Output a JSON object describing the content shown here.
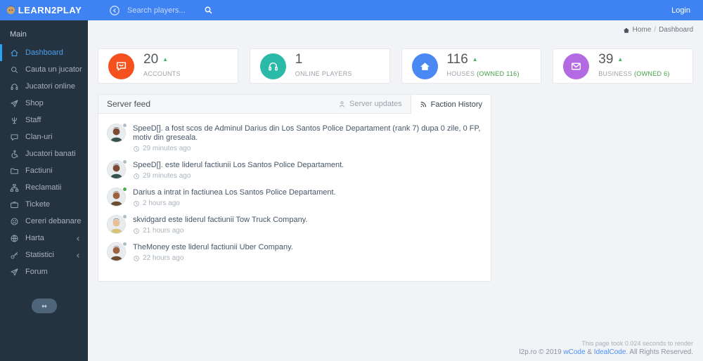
{
  "topbar": {
    "logo_text": "LEARN2PLAY",
    "search_placeholder": "Search players...",
    "login_label": "Login"
  },
  "breadcrumb": {
    "home": "Home",
    "separator": "/",
    "current": "Dashboard"
  },
  "sidebar": {
    "section_label": "Main",
    "items": [
      {
        "label": "Dashboard",
        "icon": "home",
        "active": true,
        "chevron": false
      },
      {
        "label": "Cauta un jucator",
        "icon": "search",
        "active": false,
        "chevron": false
      },
      {
        "label": "Jucatori online",
        "icon": "headset",
        "active": false,
        "chevron": false
      },
      {
        "label": "Shop",
        "icon": "send",
        "active": false,
        "chevron": false
      },
      {
        "label": "Staff",
        "icon": "trident",
        "active": false,
        "chevron": false
      },
      {
        "label": "Clan-uri",
        "icon": "chat",
        "active": false,
        "chevron": false
      },
      {
        "label": "Jucatori banati",
        "icon": "wheelchair",
        "active": false,
        "chevron": false
      },
      {
        "label": "Factiuni",
        "icon": "folder",
        "active": false,
        "chevron": false
      },
      {
        "label": "Reclamatii",
        "icon": "sitemap",
        "active": false,
        "chevron": false
      },
      {
        "label": "Tickete",
        "icon": "briefcase",
        "active": false,
        "chevron": false
      },
      {
        "label": "Cereri debanare",
        "icon": "sad-face",
        "active": false,
        "chevron": false
      },
      {
        "label": "Harta",
        "icon": "globe",
        "active": false,
        "chevron": true
      },
      {
        "label": "Statistici",
        "icon": "key",
        "active": false,
        "chevron": true
      },
      {
        "label": "Forum",
        "icon": "send",
        "active": false,
        "chevron": false
      }
    ]
  },
  "cards": [
    {
      "value": "20",
      "trend_up": true,
      "label": "ACCOUNTS",
      "owned": "",
      "icon": "chat-smile",
      "color": "#f4511e"
    },
    {
      "value": "1",
      "trend_up": false,
      "label": "ONLINE PLAYERS",
      "owned": "",
      "icon": "headset",
      "color": "#2bb9a8"
    },
    {
      "value": "116",
      "trend_up": true,
      "label": "HOUSES",
      "owned": "(OWNED 116)",
      "icon": "home-fill",
      "color": "#4a89f4"
    },
    {
      "value": "39",
      "trend_up": true,
      "label": "BUSINESS",
      "owned": "(OWNED 6)",
      "icon": "envelope",
      "color": "#b36ae2"
    }
  ],
  "feed_panel": {
    "title": "Server feed",
    "tabs": [
      {
        "label": "Server updates",
        "icon": "user",
        "active": false
      },
      {
        "label": "Faction History",
        "icon": "rss",
        "active": true
      }
    ],
    "items": [
      {
        "text": "SpeeD[]. a fost scos de Adminul Darius din Los Santos Police Departament (rank 7) dupa 0 zile, 0 FP, motiv din greseala.",
        "time": "29 minutes ago",
        "online": false,
        "avatar": {
          "skin": "#7a4b32",
          "hair": "#1d1d1d",
          "shirt": "#35514d"
        }
      },
      {
        "text": "SpeeD[]. este liderul factiunii Los Santos Police Departament.",
        "time": "29 minutes ago",
        "online": false,
        "avatar": {
          "skin": "#7a4b32",
          "hair": "#1d1d1d",
          "shirt": "#35514d"
        }
      },
      {
        "text": "Darius a intrat in factiunea Los Santos Police Departament.",
        "time": "2 hours ago",
        "online": true,
        "avatar": {
          "skin": "#9c6242",
          "hair": "#5e3c22",
          "shirt": "#6d4b2e"
        }
      },
      {
        "text": "skvidgard este liderul factiunii Tow Truck Company.",
        "time": "21 hours ago",
        "online": false,
        "avatar": {
          "skin": "#e7c098",
          "hair": "#23242a",
          "shirt": "#d9c278"
        }
      },
      {
        "text": "TheMoney este liderul factiunii Uber Company.",
        "time": "22 hours ago",
        "online": false,
        "avatar": {
          "skin": "#9c6242",
          "hair": "#5e3c22",
          "shirt": "#6d4b2e"
        }
      }
    ]
  },
  "footer": {
    "render_time": "This page took 0.024 seconds to render",
    "copy_prefix": "l2p.ro © 2019 ",
    "link1": "wCode",
    "amp": " & ",
    "link2": "IdealCode",
    "copy_suffix": ". All Rights Reserved."
  },
  "colors": {
    "topbar": "#3f82f2",
    "sidebar": "#253240",
    "active_blue": "#4aa0ec",
    "green": "#43a047",
    "online_dot": "#4caf50",
    "offline_dot": "#b0bec5"
  }
}
